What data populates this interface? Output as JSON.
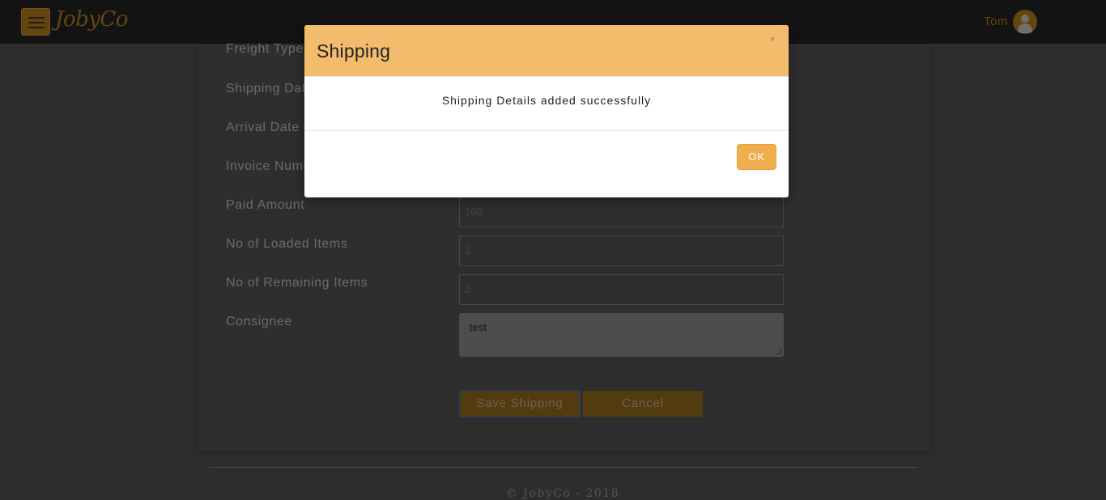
{
  "header": {
    "logo": "JobyCo",
    "user_name": "Tom"
  },
  "form": {
    "labels": {
      "freight_type": "Freight Type",
      "shipping_date": "Shipping Date",
      "arrival_date": "Arrival Date",
      "invoice_number": "Invoice Number",
      "paid_amount": "Paid Amount",
      "loaded_items": "No of Loaded Items",
      "remaining_items": "No of Remaining Items",
      "consignee": "Consignee"
    },
    "required_mark": "*",
    "values": {
      "paid_amount": "100",
      "loaded_items": "1",
      "remaining_items": "2",
      "consignee": "test"
    },
    "save_label": "Save Shipping",
    "cancel_label": "Cancel"
  },
  "footer": {
    "copyright": "© JobyCo - 2018"
  },
  "modal": {
    "title": "Shipping",
    "close_symbol": "×",
    "message": "Shipping Details added successfully",
    "ok_label": "OK"
  },
  "colors": {
    "accent": "#c98a1f",
    "modal_header": "#f2bc6c",
    "ok_button": "#f0ad4e"
  }
}
